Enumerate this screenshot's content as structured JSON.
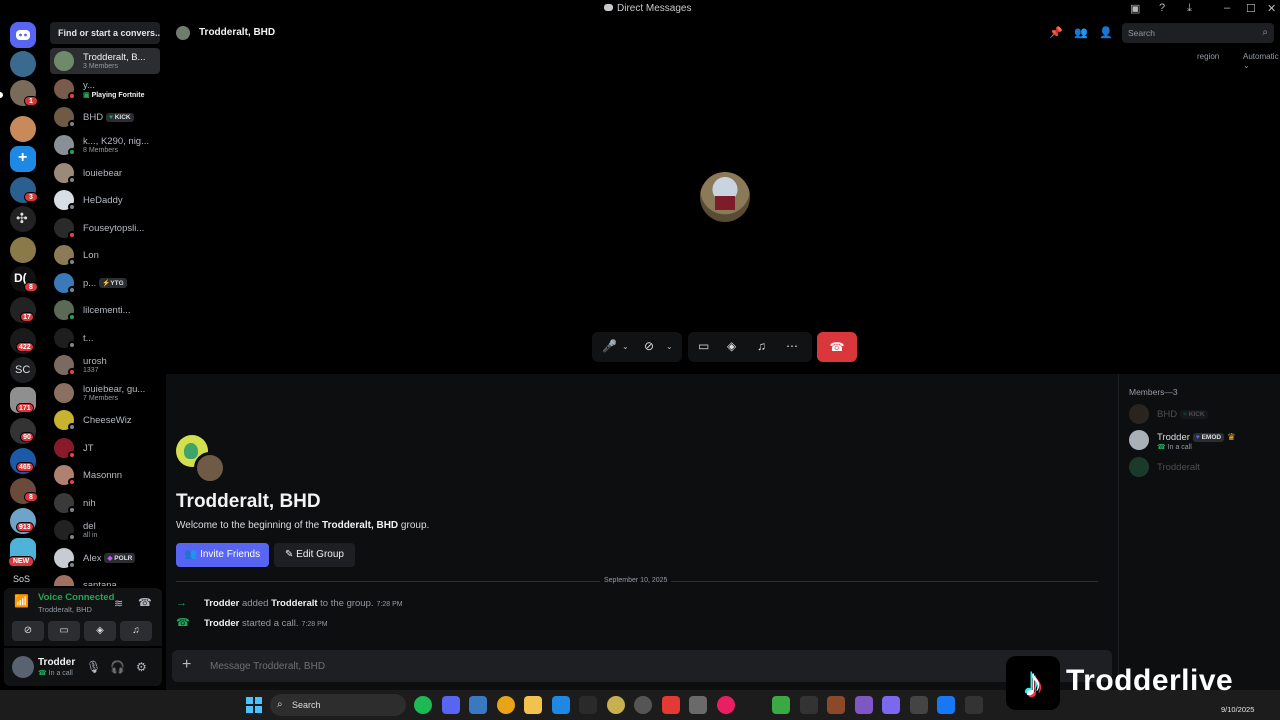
{
  "titlebar": {
    "title": "Direct Messages"
  },
  "rail": {
    "badges": [
      "1",
      "3",
      "8",
      "17",
      "422",
      "171",
      "90",
      "465",
      "8",
      "913"
    ],
    "sc_label": "SC",
    "new_label": "NEW",
    "sos_label": "SoS"
  },
  "dm_list": {
    "search_placeholder": "Find or start a convers...",
    "items": [
      {
        "name": "Trodderalt, B...",
        "sub": "3 Members"
      },
      {
        "name": "y...",
        "sub": "Playing Fortnite"
      },
      {
        "name": "BHD",
        "tag": "KICK"
      },
      {
        "name": "k..., K290, nig...",
        "sub": "8 Members"
      },
      {
        "name": "louiebear"
      },
      {
        "name": "HeDaddy"
      },
      {
        "name": "Fouseytopsli..."
      },
      {
        "name": "Lon"
      },
      {
        "name": "p...",
        "tag": "YTG"
      },
      {
        "name": "lilcementi..."
      },
      {
        "name": "t..."
      },
      {
        "name": "urosh",
        "sub": "1337"
      },
      {
        "name": "louiebear, gu...",
        "sub": "7 Members"
      },
      {
        "name": "CheeseWiz"
      },
      {
        "name": "JT"
      },
      {
        "name": "Masonnn"
      },
      {
        "name": "nih"
      },
      {
        "name": "del",
        "sub": "all in"
      },
      {
        "name": "Alex",
        "tag": "POLR"
      },
      {
        "name": "santana"
      }
    ]
  },
  "voice_panel": {
    "status": "Voice Connected",
    "channel": "Trodderalt, BHD"
  },
  "user_bar": {
    "name": "Trodder",
    "status": "In a call"
  },
  "header": {
    "title": "Trodderalt, BHD",
    "search_placeholder": "Search"
  },
  "call": {
    "region_label": "region",
    "region_value": "Automatic"
  },
  "chat": {
    "group_title": "Trodderalt, BHD",
    "welcome_prefix": "Welcome to the beginning of the ",
    "welcome_group": "Trodderalt, BHD",
    "welcome_suffix": " group.",
    "invite_label": "Invite Friends",
    "edit_label": "Edit Group",
    "date_divider": "September 10, 2025",
    "messages": [
      {
        "actor": "Trodder",
        "verb": "added",
        "target": "Trodderalt",
        "rest": "to the group.",
        "time": "7:28 PM"
      },
      {
        "actor": "Trodder",
        "verb": "started a call.",
        "time": "7:28 PM"
      }
    ],
    "composer_placeholder": "Message Trodderalt, BHD"
  },
  "members": {
    "header": "Members—3",
    "list": [
      {
        "name": "BHD",
        "tag": "KICK",
        "offline": true
      },
      {
        "name": "Trodder",
        "tag": "EMOD",
        "sub": "In a call",
        "offline": false
      },
      {
        "name": "Trodderalt",
        "offline": true
      }
    ]
  },
  "taskbar": {
    "search_label": "Search",
    "date": "9/10/2025"
  },
  "watermark": {
    "text": "Trodderlive"
  },
  "colors": {
    "accent": "#5865f2",
    "danger": "#da373c",
    "online": "#23a55a"
  }
}
